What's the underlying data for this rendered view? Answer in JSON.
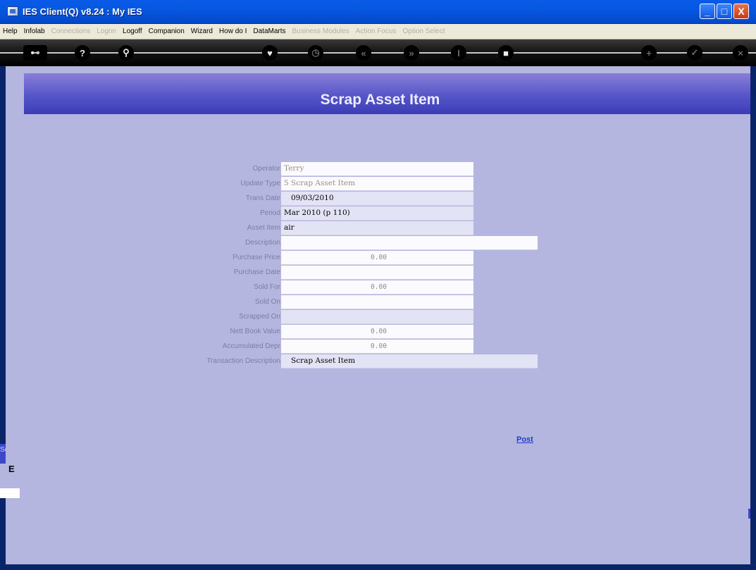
{
  "window": {
    "title": "IES Client(Q) v8.24 : My IES",
    "minimize": "_",
    "maximize": "□",
    "close": "X"
  },
  "menu": [
    {
      "label": "Help",
      "enabled": true
    },
    {
      "label": "Infolab",
      "enabled": true
    },
    {
      "label": "Connections",
      "enabled": false
    },
    {
      "label": "Logon",
      "enabled": false
    },
    {
      "label": "Logoff",
      "enabled": true
    },
    {
      "label": "Companion",
      "enabled": true
    },
    {
      "label": "Wizard",
      "enabled": true
    },
    {
      "label": "How do I",
      "enabled": true
    },
    {
      "label": "DataMarts",
      "enabled": true
    },
    {
      "label": "Business Modules",
      "enabled": false
    },
    {
      "label": "Action Focus",
      "enabled": false
    },
    {
      "label": "Option Select",
      "enabled": false
    }
  ],
  "toolbar": {
    "icons": [
      "key-icon",
      "help-icon",
      "search-icon",
      "heart-icon",
      "clock-icon",
      "rewind-icon",
      "fast-forward-icon",
      "text-cursor-icon",
      "stop-icon",
      "add-icon",
      "check-icon",
      "close-icon"
    ],
    "glyphs": {
      "key": "⊷",
      "help": "?",
      "search": "⚲",
      "heart": "♥",
      "clock": "◷",
      "rewind": "«",
      "forward": "»",
      "cursor": "I",
      "stop": "■",
      "add": "+",
      "check": "✓",
      "close": "×"
    }
  },
  "page": {
    "title": "Scrap Asset Item",
    "post_label": "Post"
  },
  "form": {
    "operator": {
      "label": "Operator",
      "value": "Terry"
    },
    "update_type": {
      "label": "Update Type",
      "value": "5 Scrap Asset Item"
    },
    "trans_date": {
      "label": "Trans Date",
      "value": "09/03/2010"
    },
    "period": {
      "label": "Period",
      "value": "Mar 2010 (p 110)"
    },
    "asset_item": {
      "label": "Asset Item",
      "value": "air"
    },
    "description": {
      "label": "Description",
      "value": ""
    },
    "purchase_price": {
      "label": "Purchase Price",
      "value": "0.00"
    },
    "purchase_date": {
      "label": "Purchase Date",
      "value": ""
    },
    "sold_for": {
      "label": "Sold For",
      "value": "0.00"
    },
    "sold_on": {
      "label": "Sold On",
      "value": ""
    },
    "scrapped_on": {
      "label": "Scrapped On",
      "value": ""
    },
    "nett_book_value": {
      "label": "Nett Book Value",
      "value": "0.00"
    },
    "accumulated_depr": {
      "label": "Accumulated Depr",
      "value": "0.00"
    },
    "transaction_description": {
      "label": "Transaction Description",
      "value": "Scrap Asset Item"
    }
  },
  "side_panel": {
    "tab_label": "Se",
    "box_text": "E"
  }
}
